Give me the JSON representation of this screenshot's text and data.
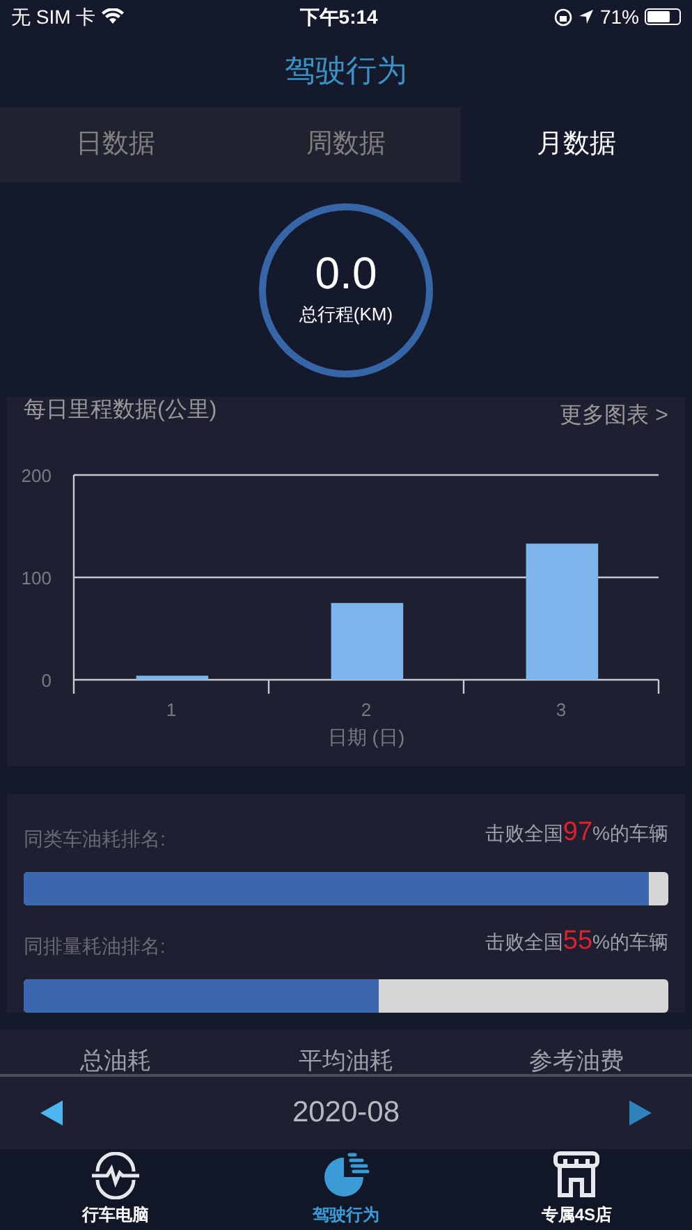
{
  "status_bar": {
    "carrier": "无 SIM 卡",
    "time": "下午5:14",
    "battery": "71%"
  },
  "title": "驾驶行为",
  "tabs": [
    {
      "label": "日数据",
      "selected": false
    },
    {
      "label": "周数据",
      "selected": false
    },
    {
      "label": "月数据",
      "selected": true
    }
  ],
  "total": {
    "value": "0.0",
    "label": "总行程(KM)"
  },
  "mileage_card": {
    "title": "每日里程数据(公里)",
    "more_link": "更多图表 >",
    "chart_data": {
      "type": "bar",
      "xlabel": "日期 (日)",
      "categories": [
        "1",
        "2",
        "3"
      ],
      "values": [
        4,
        75,
        133
      ],
      "ylim": [
        0,
        200
      ],
      "yticks": [
        0,
        100,
        200
      ]
    }
  },
  "rankings": [
    {
      "label": "同类车油耗排名:",
      "prefix": "击败全国",
      "value": "97",
      "suffix": "%的车辆",
      "level": 0.97
    },
    {
      "label": "同排量耗油排名:",
      "prefix": "击败全国",
      "value": "55",
      "suffix": "%的车辆",
      "level": 0.55
    }
  ],
  "fuel_columns": [
    "总油耗",
    "平均油耗",
    "参考油费"
  ],
  "date_bar": {
    "date": "2020-08"
  },
  "bottom_nav": [
    {
      "label": "行车电脑",
      "selected": false,
      "kind": "computer"
    },
    {
      "label": "驾驶行为",
      "selected": true,
      "kind": "behavior"
    },
    {
      "label": "专属4S店",
      "selected": false,
      "kind": "store"
    }
  ]
}
